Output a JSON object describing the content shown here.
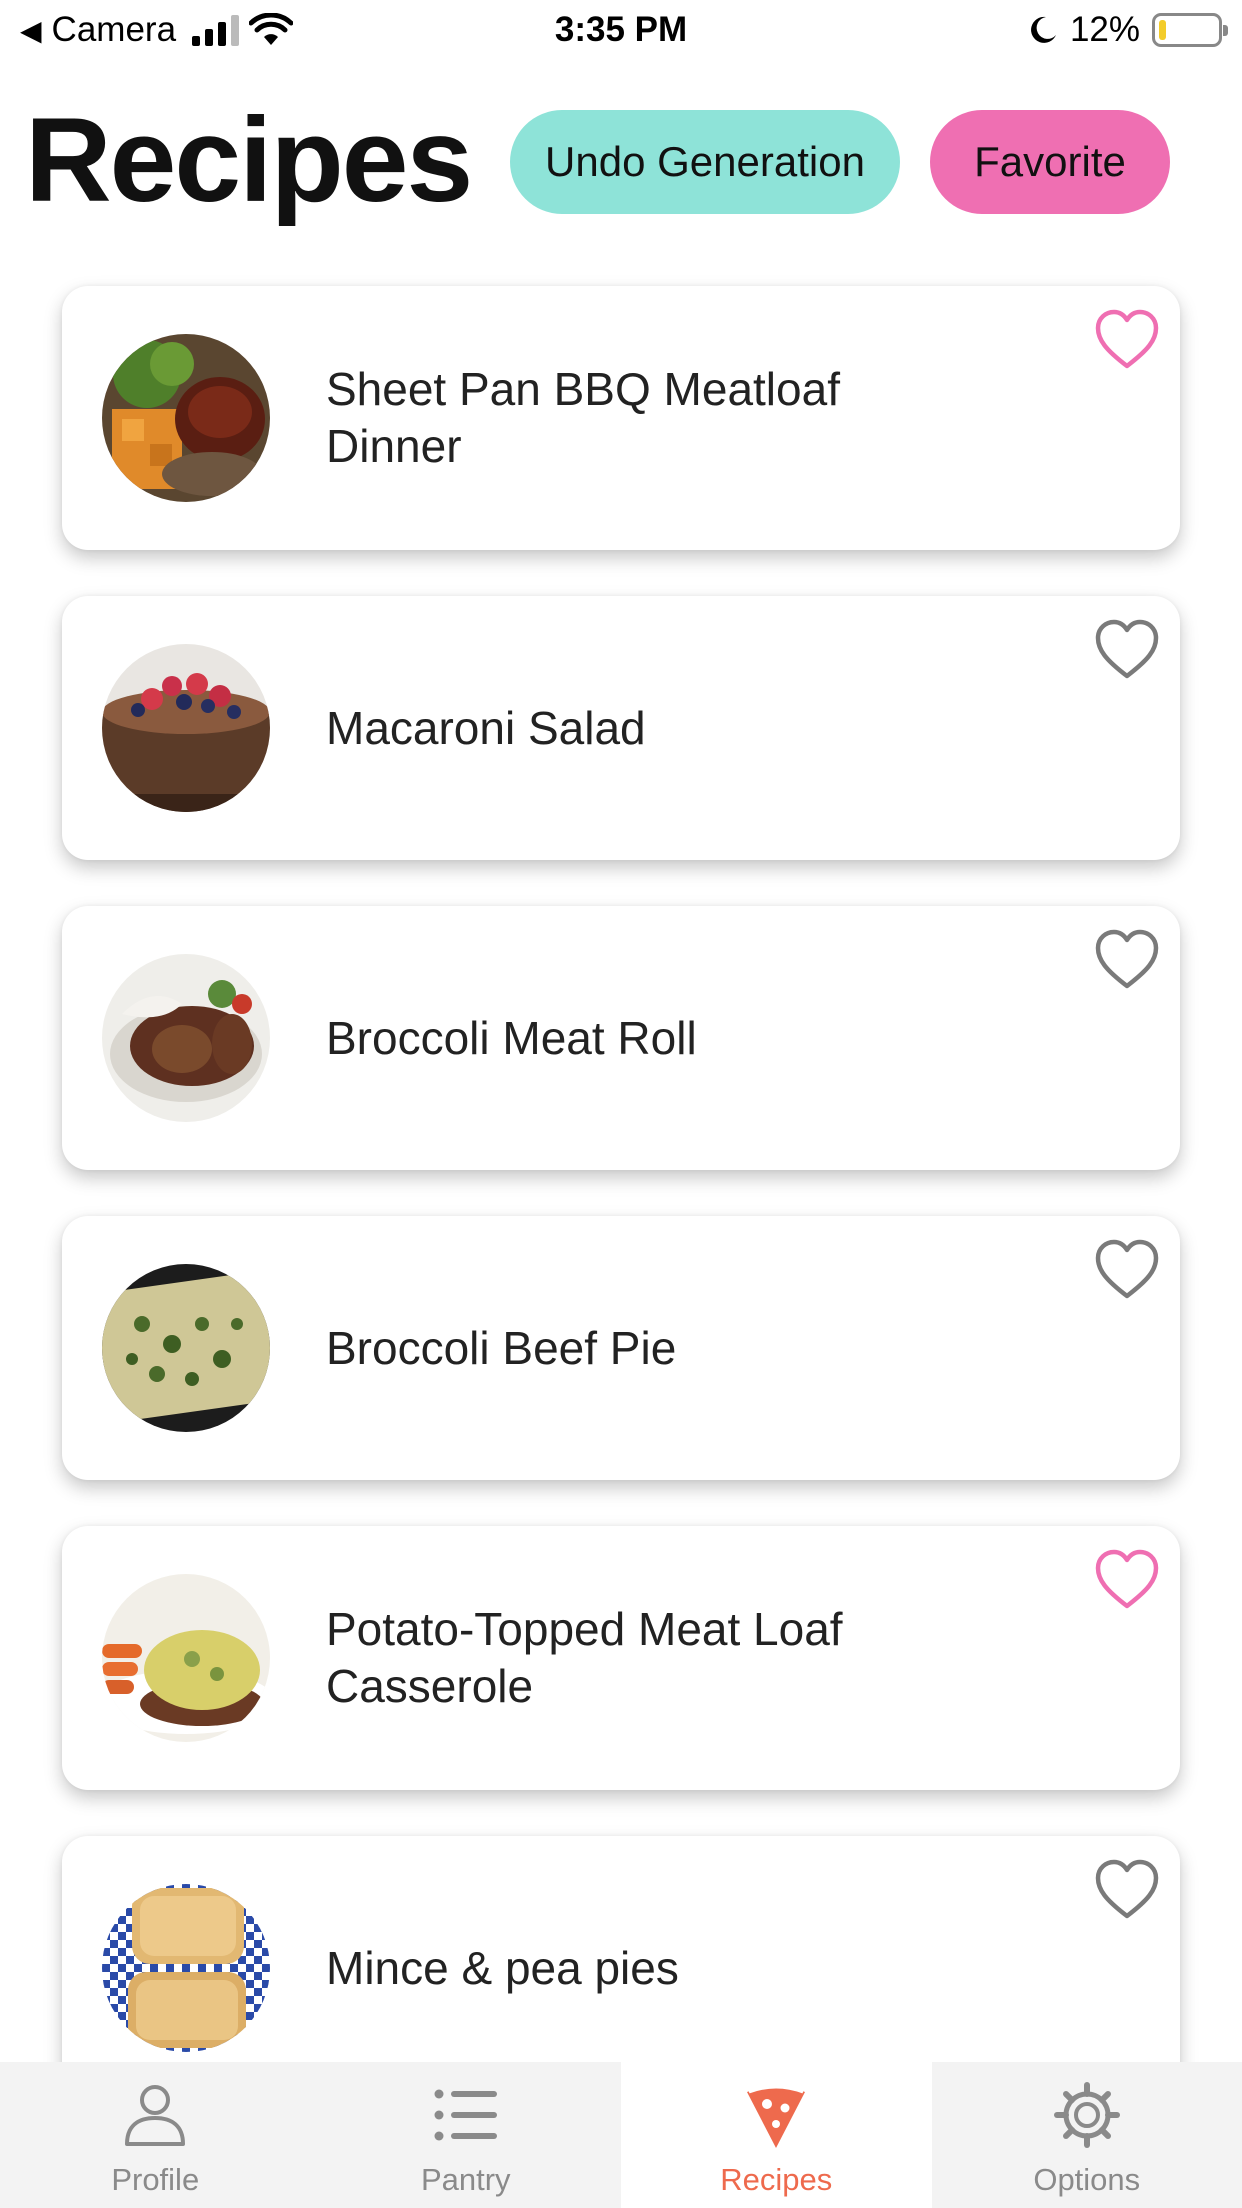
{
  "status_bar": {
    "back_label": "Camera",
    "time": "3:35 PM",
    "battery": "12%",
    "battery_level": 0.12
  },
  "header": {
    "title": "Recipes",
    "undo_label": "Undo Generation",
    "favorite_label": "Favorite"
  },
  "colors": {
    "undo_button": "#8ee3d8",
    "favorite_button": "#ef6fb2",
    "heart_favorited": "#ef6fb2",
    "heart_default": "#7a7a7a",
    "tab_active": "#ee6a4d"
  },
  "recipes": [
    {
      "title": "Sheet Pan BBQ Meatloaf Dinner",
      "favorited": true
    },
    {
      "title": "Macaroni Salad",
      "favorited": false
    },
    {
      "title": "Broccoli Meat Roll",
      "favorited": false
    },
    {
      "title": "Broccoli Beef Pie",
      "favorited": false
    },
    {
      "title": "Potato-Topped Meat Loaf Casserole",
      "favorited": true
    },
    {
      "title": "Mince & pea pies",
      "favorited": false
    }
  ],
  "tabs": [
    {
      "label": "Profile",
      "icon": "person-icon",
      "active": false
    },
    {
      "label": "Pantry",
      "icon": "list-icon",
      "active": false
    },
    {
      "label": "Recipes",
      "icon": "pizza-icon",
      "active": true
    },
    {
      "label": "Options",
      "icon": "gear-icon",
      "active": false
    }
  ]
}
